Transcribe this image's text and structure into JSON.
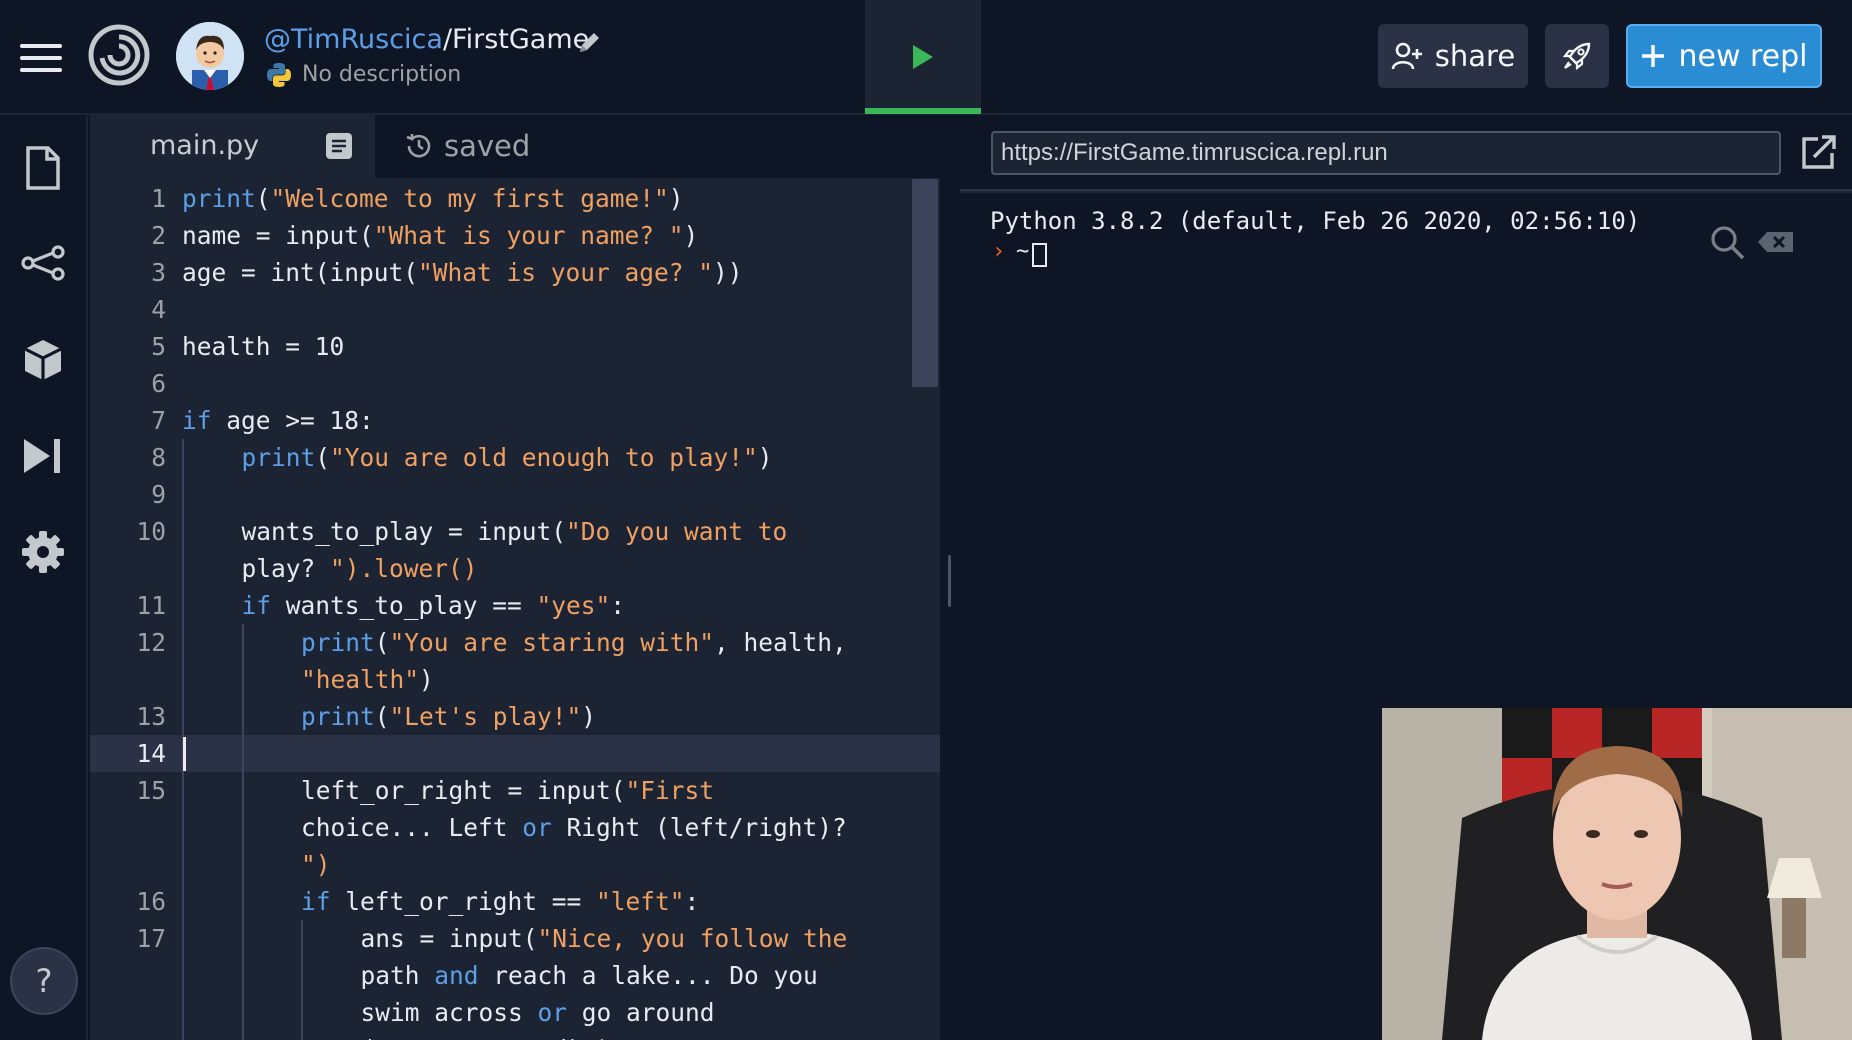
{
  "header": {
    "owner": "@TimRuscica",
    "separator": "/",
    "repl_name": "FirstGame",
    "description": "No description",
    "share_label": "share",
    "new_repl_label": "new repl"
  },
  "editor": {
    "filename": "main.py",
    "save_status": "saved",
    "active_line": 14,
    "lines": [
      {
        "n": "1",
        "indent": 0,
        "text": "print(\"Welcome to my first game!\")"
      },
      {
        "n": "2",
        "indent": 0,
        "text": "name = input(\"What is your name? \")"
      },
      {
        "n": "3",
        "indent": 0,
        "text": "age = int(input(\"What is your age? \"))"
      },
      {
        "n": "4",
        "indent": 0,
        "text": ""
      },
      {
        "n": "5",
        "indent": 0,
        "text": "health = 10"
      },
      {
        "n": "6",
        "indent": 0,
        "text": ""
      },
      {
        "n": "7",
        "indent": 0,
        "text": "if age >= 18:"
      },
      {
        "n": "8",
        "indent": 1,
        "text": "print(\"You are old enough to play!\")"
      },
      {
        "n": "9",
        "indent": 0,
        "text": ""
      },
      {
        "n": "10",
        "indent": 1,
        "text": "wants_to_play = input(\"Do you want to"
      },
      {
        "n": "",
        "indent": 1,
        "text": "play? \").lower()"
      },
      {
        "n": "11",
        "indent": 1,
        "text": "if wants_to_play == \"yes\":"
      },
      {
        "n": "12",
        "indent": 2,
        "text": "print(\"You are staring with\", health,"
      },
      {
        "n": "",
        "indent": 2,
        "text": "\"health\")"
      },
      {
        "n": "13",
        "indent": 2,
        "text": "print(\"Let's play!\")"
      },
      {
        "n": "14",
        "indent": 0,
        "text": ""
      },
      {
        "n": "15",
        "indent": 2,
        "text": "left_or_right = input(\"First"
      },
      {
        "n": "",
        "indent": 2,
        "text": "choice... Left or Right (left/right)?"
      },
      {
        "n": "",
        "indent": 2,
        "text": "\")"
      },
      {
        "n": "16",
        "indent": 2,
        "text": "if left_or_right == \"left\":"
      },
      {
        "n": "17",
        "indent": 3,
        "text": "ans = input(\"Nice, you follow the"
      },
      {
        "n": "",
        "indent": 3,
        "text": "path and reach a lake... Do you"
      },
      {
        "n": "",
        "indent": 3,
        "text": "swim across or go around"
      },
      {
        "n": "",
        "indent": 3,
        "text": "(across/around)\")"
      }
    ]
  },
  "preview": {
    "url": "https://FirstGame.timruscica.repl.run"
  },
  "console": {
    "version_line": "Python 3.8.2 (default, Feb 26 2020, 02:56:10)",
    "prompt_symbol": "›",
    "cwd": "~"
  },
  "help_label": "?",
  "colors": {
    "keyword": "#5c9fe6",
    "string": "#f0a060",
    "identifier": "#e8ecf2",
    "run_indicator": "#39b85a",
    "new_repl_button": "#2a8dd4",
    "prompt": "#f26522"
  }
}
